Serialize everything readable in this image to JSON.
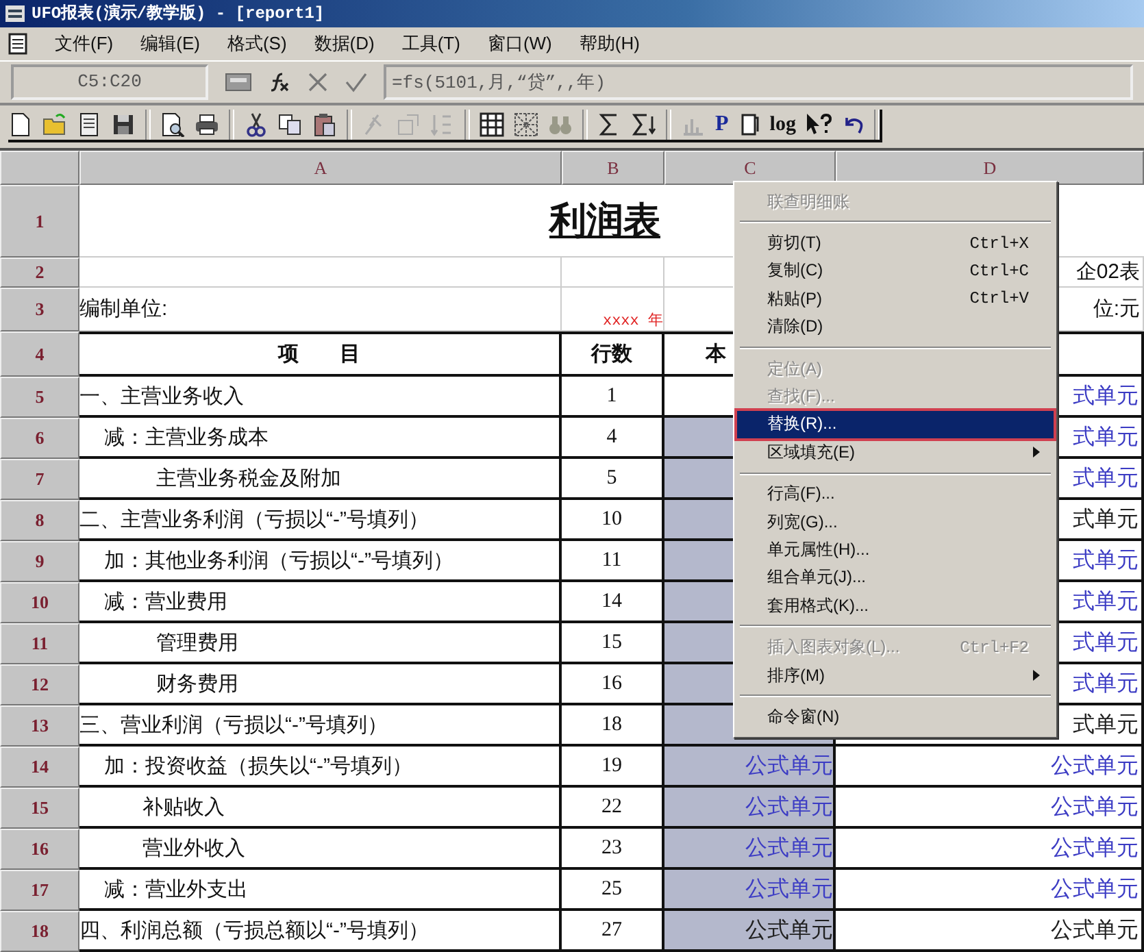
{
  "window": {
    "title": "UFO报表(演示/教学版) - [report1]"
  },
  "menu_bar": [
    {
      "label": "文件(F)"
    },
    {
      "label": "编辑(E)"
    },
    {
      "label": "格式(S)"
    },
    {
      "label": "数据(D)"
    },
    {
      "label": "工具(T)"
    },
    {
      "label": "窗口(W)"
    },
    {
      "label": "帮助(H)"
    }
  ],
  "formula_bar": {
    "cell_ref": "C5:C20",
    "formula": "=fs(5101,月,“贷”,,年)"
  },
  "toolbar": {
    "text_buttons": [
      "P",
      "log"
    ]
  },
  "sheet": {
    "columns": [
      "A",
      "B",
      "C",
      "D"
    ],
    "top_row_numbers": [
      "1",
      "2",
      "3",
      "4"
    ],
    "title": "利润表",
    "report_code": "企02表",
    "compiler_label": "编制单位:",
    "period": "xxxx 年",
    "unit": "位:元",
    "header": [
      "项　　目",
      "行数",
      "本"
    ],
    "rows": [
      {
        "number": "5",
        "kind": "section",
        "item": "一、主营业务收入",
        "line": "1",
        "c": {
          "selected": false
        },
        "d": {
          "text": "式单元",
          "color": "#3c3cc4"
        }
      },
      {
        "number": "6",
        "kind": "adjust",
        "item": "减：主营业务成本",
        "line": "4",
        "c": {
          "selected": true
        },
        "d": {
          "text": "式单元",
          "color": "#3c3cc4"
        }
      },
      {
        "number": "7",
        "kind": "detail",
        "item": "主营业务税金及附加",
        "line": "5",
        "c": {
          "selected": true
        },
        "d": {
          "text": "式单元",
          "color": "#3c3cc4"
        }
      },
      {
        "number": "8",
        "kind": "section",
        "item": "二、主营业务利润（亏损以“-”号填列）",
        "line": "10",
        "c": {
          "selected": true
        },
        "d": {
          "text": "式单元",
          "color": "#202020"
        }
      },
      {
        "number": "9",
        "kind": "adjust",
        "item": "加：其他业务利润（亏损以“-”号填列）",
        "line": "11",
        "c": {
          "selected": true
        },
        "d": {
          "text": "式单元",
          "color": "#3c3cc4"
        }
      },
      {
        "number": "10",
        "kind": "adjust",
        "item": "减：营业费用",
        "line": "14",
        "c": {
          "selected": true
        },
        "d": {
          "text": "式单元",
          "color": "#3c3cc4"
        }
      },
      {
        "number": "11",
        "kind": "detail",
        "item": "管理费用",
        "line": "15",
        "c": {
          "selected": true
        },
        "d": {
          "text": "式单元",
          "color": "#3c3cc4"
        }
      },
      {
        "number": "12",
        "kind": "detail",
        "item": "财务费用",
        "line": "16",
        "c": {
          "selected": true
        },
        "d": {
          "text": "式单元",
          "color": "#3c3cc4"
        }
      },
      {
        "number": "13",
        "kind": "section",
        "item": "三、营业利润（亏损以“-”号填列）",
        "line": "18",
        "c": {
          "selected": true
        },
        "d": {
          "text": "式单元",
          "color": "#202020"
        }
      },
      {
        "number": "14",
        "kind": "adjust",
        "item": "加：投资收益（损失以“-”号填列）",
        "line": "19",
        "c": {
          "selected": true,
          "text": "公式单元",
          "color": "#3c3cc4"
        },
        "d": {
          "text": "公式单元",
          "color": "#3c3cc4"
        }
      },
      {
        "number": "15",
        "kind": "minor",
        "item": "补贴收入",
        "line": "22",
        "c": {
          "selected": true,
          "text": "公式单元",
          "color": "#3c3cc4"
        },
        "d": {
          "text": "公式单元",
          "color": "#3c3cc4"
        }
      },
      {
        "number": "16",
        "kind": "minor",
        "item": "营业外收入",
        "line": "23",
        "c": {
          "selected": true,
          "text": "公式单元",
          "color": "#3c3cc4"
        },
        "d": {
          "text": "公式单元",
          "color": "#3c3cc4"
        }
      },
      {
        "number": "17",
        "kind": "adjust",
        "item": "减：营业外支出",
        "line": "25",
        "c": {
          "selected": true,
          "text": "公式单元",
          "color": "#3c3cc4"
        },
        "d": {
          "text": "公式单元",
          "color": "#3c3cc4"
        }
      },
      {
        "number": "18",
        "kind": "section",
        "item": "四、利润总额（亏损总额以“-”号填列）",
        "line": "27",
        "c": {
          "selected": true,
          "text": "公式单元",
          "color": "#202020"
        },
        "d": {
          "text": "公式单元",
          "color": "#202020"
        }
      }
    ]
  },
  "context_menu": {
    "items": [
      {
        "label": "联查明细账",
        "disabled": true,
        "selected": false
      },
      {
        "label": "剪切(T)",
        "shortcut": "Ctrl+X",
        "separator_before": true,
        "disabled": false,
        "selected": false
      },
      {
        "label": "复制(C)",
        "shortcut": "Ctrl+C",
        "disabled": false,
        "selected": false
      },
      {
        "label": "粘贴(P)",
        "shortcut": "Ctrl+V",
        "disabled": false,
        "selected": false
      },
      {
        "label": "清除(D)",
        "disabled": false,
        "selected": false
      },
      {
        "label": "定位(A)",
        "separator_before": true,
        "disabled": true,
        "selected": false
      },
      {
        "label": "查找(F)...",
        "disabled": true,
        "selected": false
      },
      {
        "label": "替换(R)...",
        "disabled": false,
        "selected": true
      },
      {
        "label": "区域填充(E)",
        "submenu": true,
        "disabled": false,
        "selected": false
      },
      {
        "label": "行高(F)...",
        "separator_before": true,
        "disabled": false,
        "selected": false
      },
      {
        "label": "列宽(G)...",
        "disabled": false,
        "selected": false
      },
      {
        "label": "单元属性(H)...",
        "disabled": false,
        "selected": false
      },
      {
        "label": "组合单元(J)...",
        "disabled": false,
        "selected": false
      },
      {
        "label": "套用格式(K)...",
        "disabled": false,
        "selected": false
      },
      {
        "label": "插入图表对象(L)...",
        "shortcut": "Ctrl+F2",
        "separator_before": true,
        "disabled": true,
        "selected": false
      },
      {
        "label": "排序(M)",
        "submenu": true,
        "disabled": false,
        "selected": false
      },
      {
        "label": "命令窗(N)",
        "separator_before": true,
        "disabled": false,
        "selected": false
      }
    ]
  }
}
